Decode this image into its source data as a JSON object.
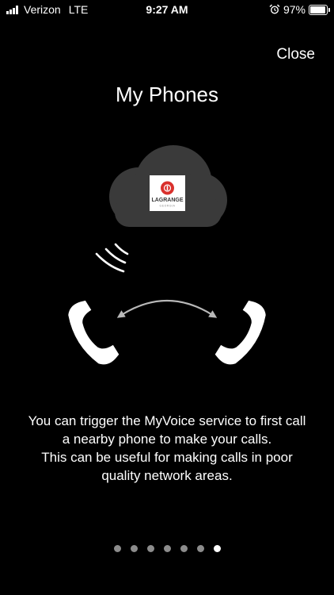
{
  "status_bar": {
    "carrier": "Verizon",
    "network": "LTE",
    "time": "9:27 AM",
    "battery_percent_label": "97%",
    "battery_level": 0.97,
    "icons": [
      "signal-bars-icon",
      "alarm-icon",
      "battery-icon"
    ]
  },
  "header": {
    "close_label": "Close",
    "title": "My Phones"
  },
  "illustration": {
    "logo_text_main": "LAGRANGE",
    "logo_text_sub": "GEORGIA",
    "logo_accent_color": "#d9302c",
    "cloud_color": "#3a3a3a",
    "icons": [
      "cloud-icon",
      "signal-waves-icon",
      "phone-handset-left-icon",
      "double-arrow-icon",
      "phone-handset-right-icon"
    ]
  },
  "description": {
    "lines": [
      "You can trigger the MyVoice service to first call",
      "a nearby phone to make your calls.",
      "This can be useful for making calls in poor",
      "quality network areas."
    ]
  },
  "pagination": {
    "total": 7,
    "current": 7
  }
}
